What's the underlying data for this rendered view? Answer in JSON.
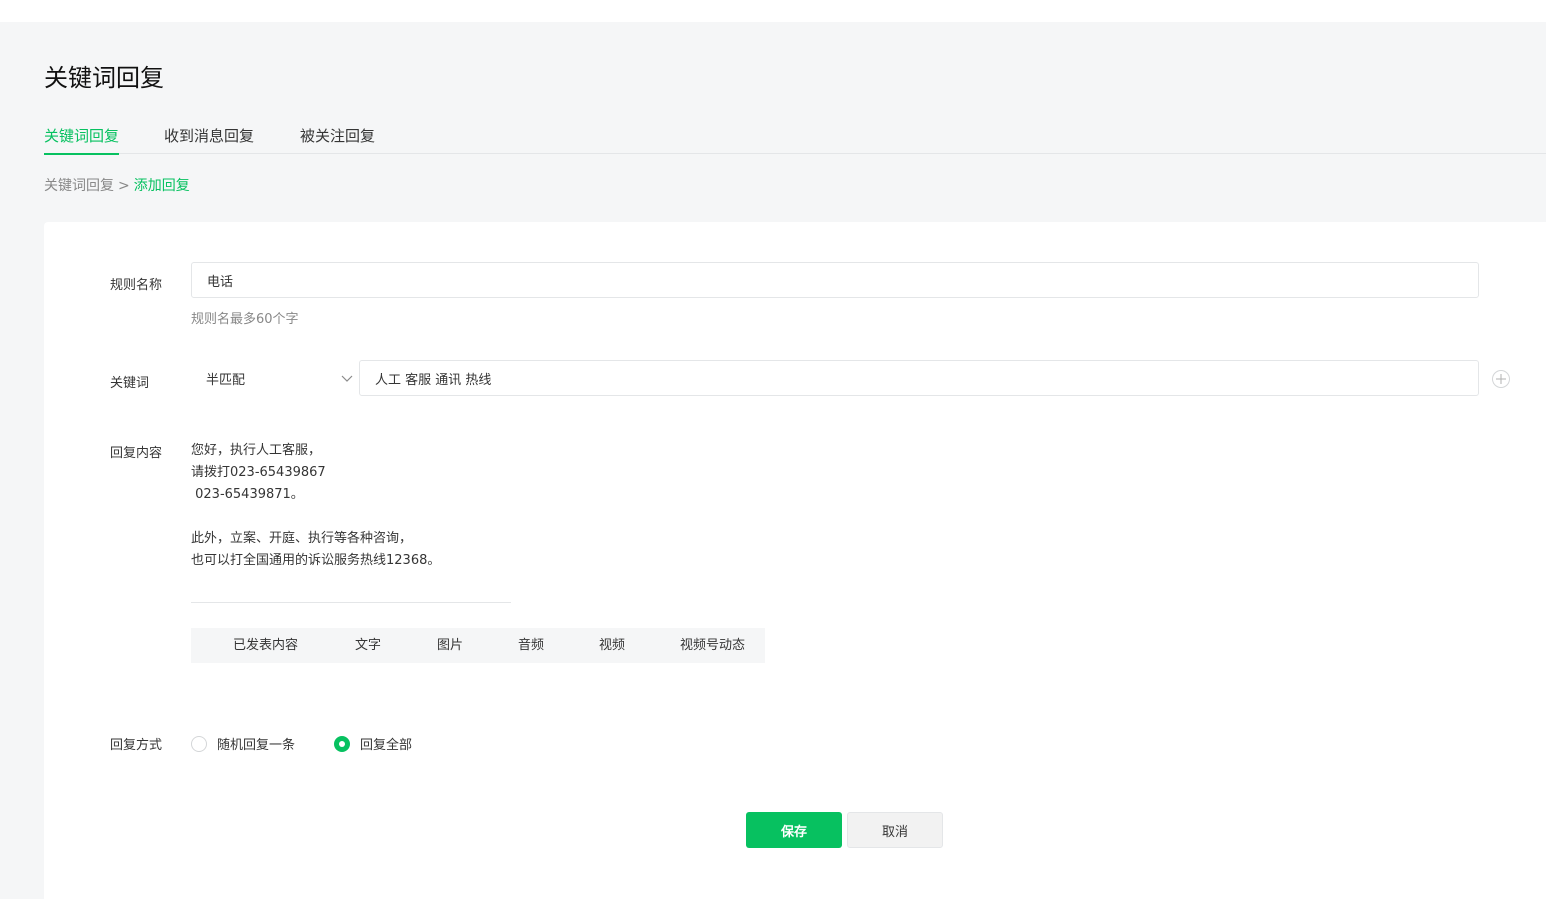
{
  "header": {
    "title": "关键词回复"
  },
  "tabs": [
    {
      "label": "关键词回复",
      "active": true
    },
    {
      "label": "收到消息回复",
      "active": false
    },
    {
      "label": "被关注回复",
      "active": false
    }
  ],
  "breadcrumb": {
    "parent": "关键词回复",
    "separator": ">",
    "current": "添加回复"
  },
  "form": {
    "rule_name": {
      "label": "规则名称",
      "value": "电话",
      "hint": "规则名最多60个字"
    },
    "keyword": {
      "label": "关键词",
      "match_mode": "半匹配",
      "value": "人工 客服 通讯 热线",
      "add_icon": "plus-circle-icon"
    },
    "reply_content": {
      "label": "回复内容",
      "text": "您好，执行人工客服，\n请拨打023-65439867\n 023-65439871。\n\n此外，立案、开庭、执行等各种咨询，\n也可以打全国通用的诉讼服务热线12368。",
      "media_types": [
        "已发表内容",
        "文字",
        "图片",
        "音频",
        "视频",
        "视频号动态"
      ]
    },
    "reply_mode": {
      "label": "回复方式",
      "options": [
        {
          "label": "随机回复一条",
          "checked": false
        },
        {
          "label": "回复全部",
          "checked": true
        }
      ]
    }
  },
  "actions": {
    "save_label": "保存",
    "cancel_label": "取消"
  },
  "colors": {
    "accent": "#07c160",
    "background": "#f5f6f7"
  }
}
